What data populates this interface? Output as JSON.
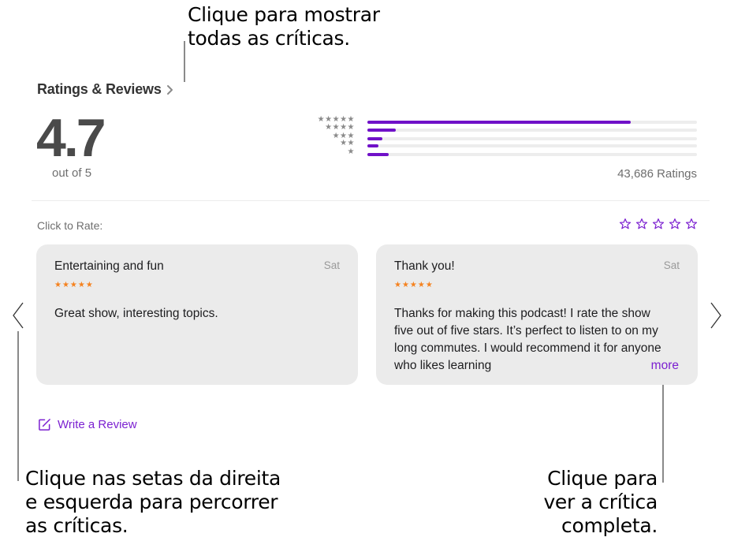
{
  "callouts": {
    "show_all": [
      "Clique para mostrar",
      "todas as críticas."
    ],
    "arrows": [
      "Clique nas setas da direita",
      "e esquerda para percorrer",
      "as críticas."
    ],
    "full_review": [
      "Clique para",
      "ver a crítica",
      "completa."
    ]
  },
  "header": {
    "title": "Ratings & Reviews",
    "chevron_icon": "chevron-right-icon"
  },
  "summary": {
    "average": "4.7",
    "out_of": "out of 5",
    "ratings_count": "43,686 Ratings"
  },
  "histogram": [
    {
      "stars": 5,
      "glyphs": "★★★★★",
      "fraction": 0.8
    },
    {
      "stars": 4,
      "glyphs": "★★★★",
      "fraction": 0.085
    },
    {
      "stars": 3,
      "glyphs": "★★★",
      "fraction": 0.045
    },
    {
      "stars": 2,
      "glyphs": "★★",
      "fraction": 0.033
    },
    {
      "stars": 1,
      "glyphs": "★",
      "fraction": 0.065
    }
  ],
  "rate": {
    "label": "Click to Rate:",
    "star_count": 5,
    "selected": 0
  },
  "reviews": [
    {
      "title": "Entertaining and fun",
      "date": "Sat",
      "stars": "★★★★★",
      "rating": 5,
      "body": "Great show, interesting topics."
    },
    {
      "title": "Thank you!",
      "date": "Sat",
      "stars": "★★★★★",
      "rating": 5,
      "body": "Thanks for making this podcast! I rate the show five out of five stars. It’s perfect to listen to on my long commutes. I would recommend it for anyone who likes learning",
      "more_label": "more"
    }
  ],
  "navigation": {
    "prev_icon": "chevron-left-icon",
    "next_icon": "chevron-right-icon"
  },
  "write_review": {
    "label": "Write a Review",
    "icon": "compose-icon"
  },
  "colors": {
    "accent": "#7c21d1",
    "bar_fill": "#7011c8",
    "review_star": "#f5821f",
    "card_bg": "#ebebeb"
  }
}
